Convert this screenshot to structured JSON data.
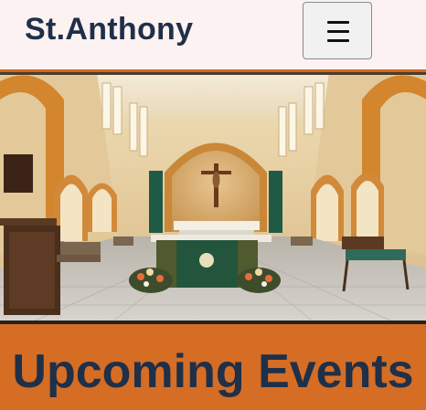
{
  "header": {
    "brand": "St.Anthony",
    "menu_icon": "hamburger-menu-icon"
  },
  "hero": {
    "image_subject": "church-interior-altar-photo"
  },
  "events": {
    "heading": "Upcoming Events"
  },
  "colors": {
    "header_bg": "#fdf2f2",
    "brand_text": "#1f3048",
    "accent": "#d56d25"
  }
}
